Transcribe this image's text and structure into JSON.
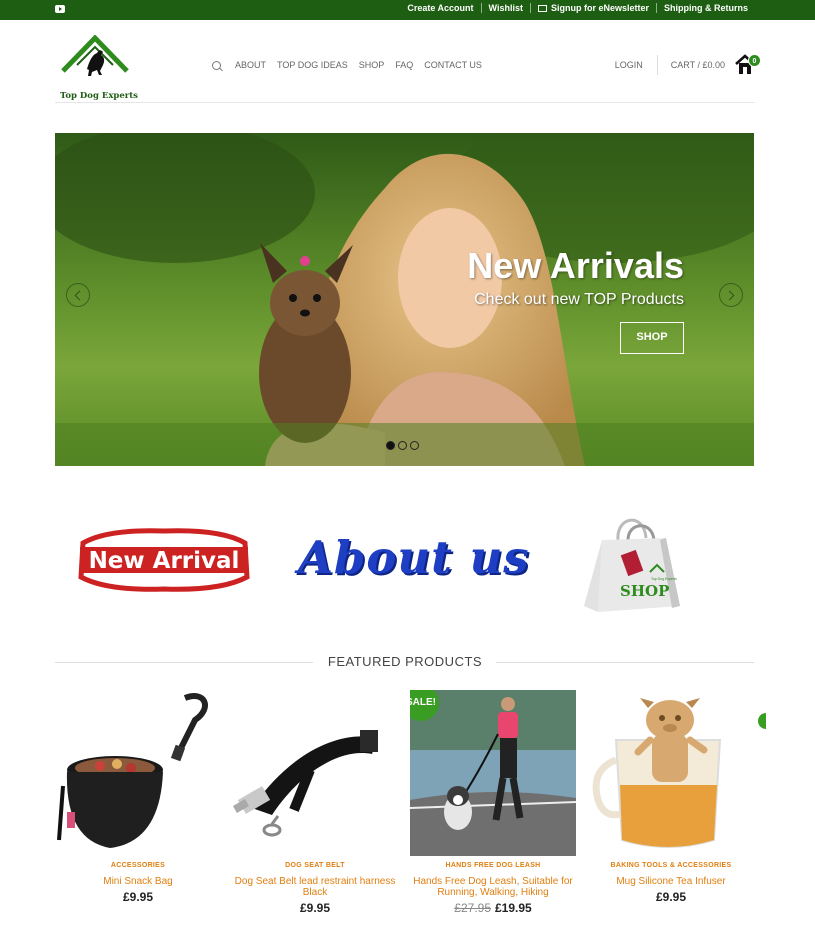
{
  "topbar": {
    "links": [
      "Create Account",
      "Wishlist",
      "Signup for eNewsletter",
      "Shipping & Returns"
    ],
    "icons": [
      "youtube-icon",
      "mail-icon"
    ],
    "bg_color": "#1d5e12"
  },
  "header": {
    "logo_text": "Top Dog Experts",
    "nav": [
      "ABOUT",
      "TOP DOG IDEAS",
      "SHOP",
      "FAQ",
      "CONTACT US"
    ],
    "login": "LOGIN",
    "cart": "CART / £0.00",
    "cart_count": "0"
  },
  "hero": {
    "title": "New Arrivals",
    "subtitle": "Check out new TOP Products",
    "button": "SHOP",
    "slides": 3,
    "active_slide": 1
  },
  "banners": {
    "new_arrival": "New Arrival",
    "about_us": "About us",
    "shop": "SHOP",
    "shop_bag_small": "Top Dog Experts"
  },
  "featured": {
    "title": "FEATURED PRODUCTS",
    "products": [
      {
        "category": "ACCESSORIES",
        "name": "Mini Snack Bag",
        "price": "£9.95"
      },
      {
        "category": "DOG SEAT BELT",
        "name": "Dog Seat Belt lead restraint harness Black",
        "price": "£9.95"
      },
      {
        "category": "HANDS FREE DOG LEASH",
        "name": "Hands Free Dog Leash, Suitable for Running, Walking, Hiking",
        "old_price": "£27.95",
        "price": "£19.95",
        "badge": "SALE!"
      },
      {
        "category": "BAKING TOOLS & ACCESSORIES",
        "name": "Mug Silicone Tea Infuser",
        "price": "£9.95"
      }
    ]
  },
  "colors": {
    "accent": "#e07f10",
    "green": "#3a9d23",
    "about": "#1e3fc4"
  }
}
